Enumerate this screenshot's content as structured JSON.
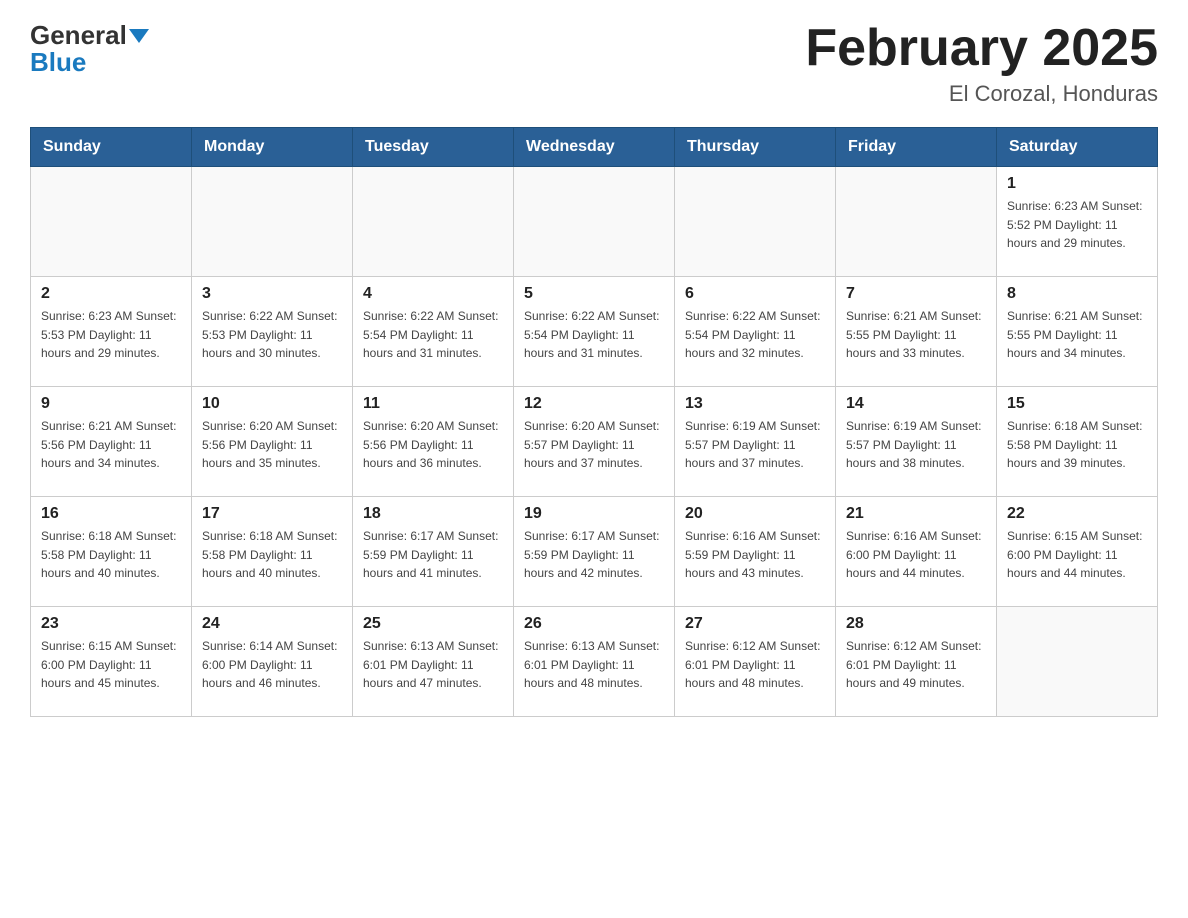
{
  "header": {
    "logo_line1": "General",
    "logo_line2": "Blue",
    "title": "February 2025",
    "subtitle": "El Corozal, Honduras"
  },
  "days_of_week": [
    "Sunday",
    "Monday",
    "Tuesday",
    "Wednesday",
    "Thursday",
    "Friday",
    "Saturday"
  ],
  "weeks": [
    [
      {
        "day": "",
        "info": ""
      },
      {
        "day": "",
        "info": ""
      },
      {
        "day": "",
        "info": ""
      },
      {
        "day": "",
        "info": ""
      },
      {
        "day": "",
        "info": ""
      },
      {
        "day": "",
        "info": ""
      },
      {
        "day": "1",
        "info": "Sunrise: 6:23 AM\nSunset: 5:52 PM\nDaylight: 11 hours\nand 29 minutes."
      }
    ],
    [
      {
        "day": "2",
        "info": "Sunrise: 6:23 AM\nSunset: 5:53 PM\nDaylight: 11 hours\nand 29 minutes."
      },
      {
        "day": "3",
        "info": "Sunrise: 6:22 AM\nSunset: 5:53 PM\nDaylight: 11 hours\nand 30 minutes."
      },
      {
        "day": "4",
        "info": "Sunrise: 6:22 AM\nSunset: 5:54 PM\nDaylight: 11 hours\nand 31 minutes."
      },
      {
        "day": "5",
        "info": "Sunrise: 6:22 AM\nSunset: 5:54 PM\nDaylight: 11 hours\nand 31 minutes."
      },
      {
        "day": "6",
        "info": "Sunrise: 6:22 AM\nSunset: 5:54 PM\nDaylight: 11 hours\nand 32 minutes."
      },
      {
        "day": "7",
        "info": "Sunrise: 6:21 AM\nSunset: 5:55 PM\nDaylight: 11 hours\nand 33 minutes."
      },
      {
        "day": "8",
        "info": "Sunrise: 6:21 AM\nSunset: 5:55 PM\nDaylight: 11 hours\nand 34 minutes."
      }
    ],
    [
      {
        "day": "9",
        "info": "Sunrise: 6:21 AM\nSunset: 5:56 PM\nDaylight: 11 hours\nand 34 minutes."
      },
      {
        "day": "10",
        "info": "Sunrise: 6:20 AM\nSunset: 5:56 PM\nDaylight: 11 hours\nand 35 minutes."
      },
      {
        "day": "11",
        "info": "Sunrise: 6:20 AM\nSunset: 5:56 PM\nDaylight: 11 hours\nand 36 minutes."
      },
      {
        "day": "12",
        "info": "Sunrise: 6:20 AM\nSunset: 5:57 PM\nDaylight: 11 hours\nand 37 minutes."
      },
      {
        "day": "13",
        "info": "Sunrise: 6:19 AM\nSunset: 5:57 PM\nDaylight: 11 hours\nand 37 minutes."
      },
      {
        "day": "14",
        "info": "Sunrise: 6:19 AM\nSunset: 5:57 PM\nDaylight: 11 hours\nand 38 minutes."
      },
      {
        "day": "15",
        "info": "Sunrise: 6:18 AM\nSunset: 5:58 PM\nDaylight: 11 hours\nand 39 minutes."
      }
    ],
    [
      {
        "day": "16",
        "info": "Sunrise: 6:18 AM\nSunset: 5:58 PM\nDaylight: 11 hours\nand 40 minutes."
      },
      {
        "day": "17",
        "info": "Sunrise: 6:18 AM\nSunset: 5:58 PM\nDaylight: 11 hours\nand 40 minutes."
      },
      {
        "day": "18",
        "info": "Sunrise: 6:17 AM\nSunset: 5:59 PM\nDaylight: 11 hours\nand 41 minutes."
      },
      {
        "day": "19",
        "info": "Sunrise: 6:17 AM\nSunset: 5:59 PM\nDaylight: 11 hours\nand 42 minutes."
      },
      {
        "day": "20",
        "info": "Sunrise: 6:16 AM\nSunset: 5:59 PM\nDaylight: 11 hours\nand 43 minutes."
      },
      {
        "day": "21",
        "info": "Sunrise: 6:16 AM\nSunset: 6:00 PM\nDaylight: 11 hours\nand 44 minutes."
      },
      {
        "day": "22",
        "info": "Sunrise: 6:15 AM\nSunset: 6:00 PM\nDaylight: 11 hours\nand 44 minutes."
      }
    ],
    [
      {
        "day": "23",
        "info": "Sunrise: 6:15 AM\nSunset: 6:00 PM\nDaylight: 11 hours\nand 45 minutes."
      },
      {
        "day": "24",
        "info": "Sunrise: 6:14 AM\nSunset: 6:00 PM\nDaylight: 11 hours\nand 46 minutes."
      },
      {
        "day": "25",
        "info": "Sunrise: 6:13 AM\nSunset: 6:01 PM\nDaylight: 11 hours\nand 47 minutes."
      },
      {
        "day": "26",
        "info": "Sunrise: 6:13 AM\nSunset: 6:01 PM\nDaylight: 11 hours\nand 48 minutes."
      },
      {
        "day": "27",
        "info": "Sunrise: 6:12 AM\nSunset: 6:01 PM\nDaylight: 11 hours\nand 48 minutes."
      },
      {
        "day": "28",
        "info": "Sunrise: 6:12 AM\nSunset: 6:01 PM\nDaylight: 11 hours\nand 49 minutes."
      },
      {
        "day": "",
        "info": ""
      }
    ]
  ]
}
